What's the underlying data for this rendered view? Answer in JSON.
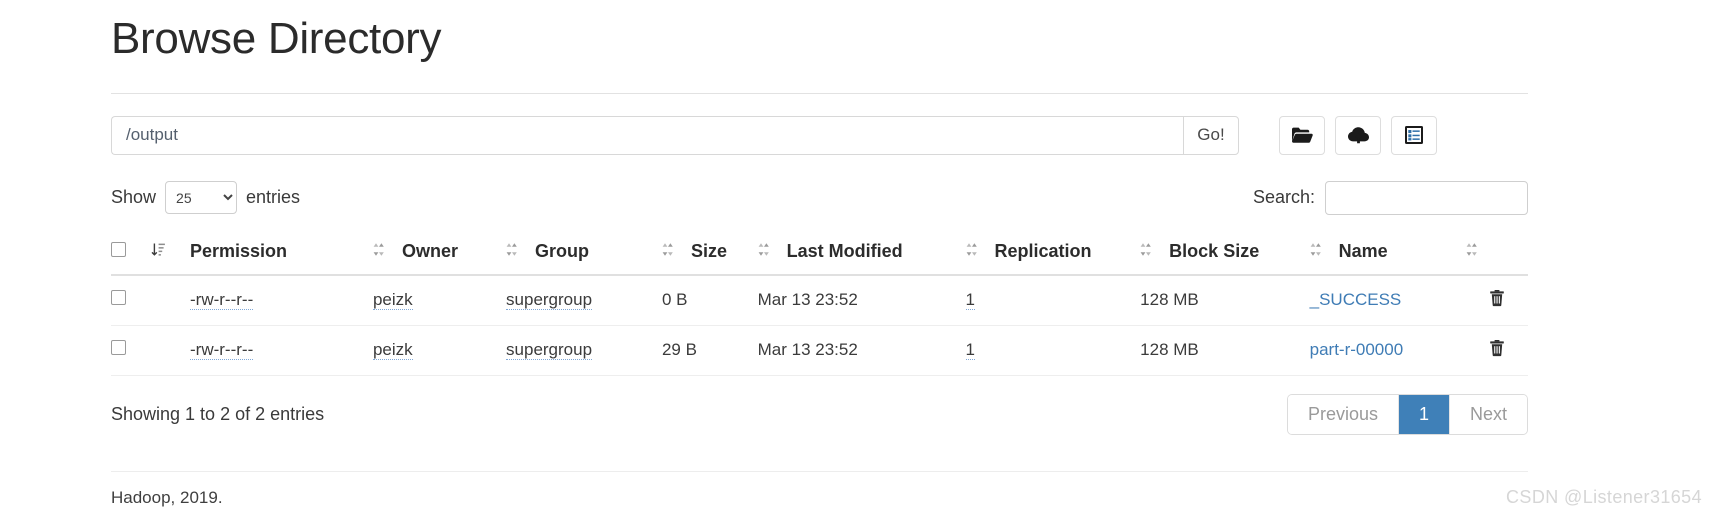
{
  "page": {
    "title": "Browse Directory"
  },
  "path_bar": {
    "value": "/output",
    "placeholder": "Enter path",
    "go_label": "Go!",
    "buttons": [
      {
        "icon": "folder-open-icon"
      },
      {
        "icon": "cloud-upload-icon"
      },
      {
        "icon": "list-clipboard-icon"
      }
    ]
  },
  "controls": {
    "show_label": "Show",
    "entries_label": "entries",
    "entries_value": "25",
    "entries_options": [
      "25"
    ],
    "search_label": "Search:",
    "search_value": "",
    "search_placeholder": ""
  },
  "table": {
    "columns": [
      {
        "label": "Permission"
      },
      {
        "label": "Owner"
      },
      {
        "label": "Group"
      },
      {
        "label": "Size"
      },
      {
        "label": "Last Modified"
      },
      {
        "label": "Replication"
      },
      {
        "label": "Block Size"
      },
      {
        "label": "Name"
      }
    ],
    "rows": [
      {
        "permission": "-rw-r--r--",
        "owner": "peizk",
        "group": "supergroup",
        "size": "0 B",
        "last_modified": "Mar 13 23:52",
        "replication": "1",
        "block_size": "128 MB",
        "name": "_SUCCESS"
      },
      {
        "permission": "-rw-r--r--",
        "owner": "peizk",
        "group": "supergroup",
        "size": "29 B",
        "last_modified": "Mar 13 23:52",
        "replication": "1",
        "block_size": "128 MB",
        "name": "part-r-00000"
      }
    ]
  },
  "footer": {
    "showing": "Showing 1 to 2 of 2 entries",
    "pagination": {
      "previous": "Previous",
      "pages": [
        "1"
      ],
      "next": "Next",
      "active_page": "1"
    },
    "copyright": "Hadoop, 2019.",
    "watermark": "CSDN @Listener31654"
  },
  "colors": {
    "accent": "#3f80b8",
    "link": "#3f7cb5",
    "text": "#333333",
    "muted": "#9a9a9a",
    "watermark": "#d6d6d6"
  }
}
